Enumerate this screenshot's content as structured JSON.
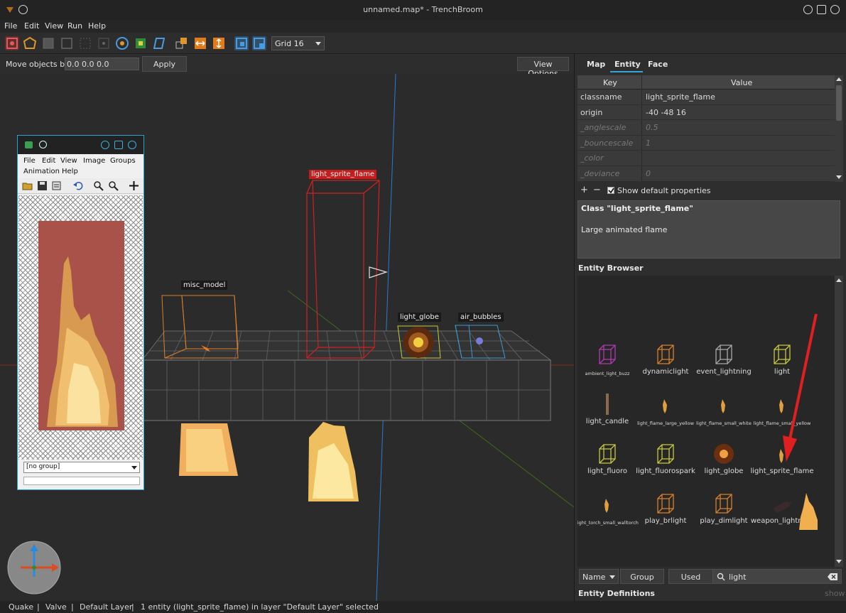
{
  "window": {
    "title": "unnamed.map* - TrenchBroom"
  },
  "menu": {
    "items": [
      "File",
      "Edit",
      "View",
      "Run",
      "Help"
    ]
  },
  "toolbar": {
    "grid_value": "Grid 16",
    "tools": [
      "select-brush-icon",
      "vertex-tool-icon",
      "edge-tool-icon",
      "face-tool-icon",
      "clip-tool-icon",
      "rotate-tool-icon",
      "texture-lock-icon",
      "uv-lock-icon",
      "shear-tool-icon",
      "duplicate-icon",
      "flip-horizontal-icon",
      "flip-vertical-icon",
      "snap-vertices-icon",
      "snap-grid-icon"
    ]
  },
  "move_bar": {
    "label": "Move objects by",
    "value": "0.0 0.0 0.0",
    "apply_label": "Apply",
    "view_options_label": "View Options"
  },
  "viewport": {
    "labels": {
      "sprite_flame": "light_sprite_flame",
      "misc_model": "misc_model",
      "light_globe": "light_globe",
      "air_bubbles": "air_bubbles"
    }
  },
  "image_viewer": {
    "menu": [
      "File",
      "Edit",
      "View",
      "Image",
      "Groups",
      "Animation",
      "Help"
    ],
    "group_select": "[no group]"
  },
  "inspector": {
    "tabs": [
      "Map",
      "Entity",
      "Face"
    ],
    "active_tab": "Entity",
    "table_headers": {
      "key": "Key",
      "value": "Value"
    },
    "rows": [
      {
        "key": "classname",
        "value": "light_sprite_flame",
        "default": false
      },
      {
        "key": "origin",
        "value": "-40 -48 16",
        "default": false
      },
      {
        "key": "_anglescale",
        "value": "0.5",
        "default": true
      },
      {
        "key": "_bouncescale",
        "value": "1",
        "default": true
      },
      {
        "key": "_color",
        "value": "",
        "default": true
      },
      {
        "key": "_deviance",
        "value": "0",
        "default": true
      }
    ],
    "add_label": "+",
    "remove_label": "−",
    "show_default_label": "Show default properties",
    "class_title": "Class \"light_sprite_flame\"",
    "class_description": "Large animated flame"
  },
  "entity_browser": {
    "title": "Entity Browser",
    "entities": [
      {
        "name": "ambient_light_buzz",
        "small": true,
        "color": "#b03ab0"
      },
      {
        "name": "dynamiclight",
        "small": false,
        "color": "#d8802a"
      },
      {
        "name": "event_lightning",
        "small": false,
        "color": "#a8a8a8"
      },
      {
        "name": "light",
        "small": false,
        "color": "#c8c83a"
      },
      {
        "name": "light_candle",
        "small": false,
        "color": "#8a6a4a"
      },
      {
        "name": "light_flame_large_yellow",
        "small": true,
        "color": "#e0a040"
      },
      {
        "name": "light_flame_small_white",
        "small": true,
        "color": "#e0a040"
      },
      {
        "name": "light_flame_small_yellow",
        "small": true,
        "color": "#e0a040"
      },
      {
        "name": "light_fluoro",
        "small": false,
        "color": "#c8c83a"
      },
      {
        "name": "light_fluorospark",
        "small": false,
        "color": "#c8c83a"
      },
      {
        "name": "light_globe",
        "small": false,
        "color": "#d07020"
      },
      {
        "name": "light_sprite_flame",
        "small": false,
        "color": "#e0a040"
      },
      {
        "name": "light_torch_small_walltorch",
        "small": true,
        "color": "#e0a040"
      },
      {
        "name": "play_brlight",
        "small": false,
        "color": "#d8802a"
      },
      {
        "name": "play_dimlight",
        "small": false,
        "color": "#d8802a"
      },
      {
        "name": "weapon_lightning",
        "small": false,
        "color": "#555"
      }
    ],
    "sort_select": "Name",
    "group_label": "Group",
    "used_label": "Used",
    "search_value": "light"
  },
  "entity_definitions": {
    "title": "Entity Definitions",
    "show_label": "show"
  },
  "status_bar": {
    "game": "Quake",
    "format": "Valve",
    "layer": "Default Layer",
    "selection": "1 entity (light_sprite_flame) in layer \"Default Layer\" selected"
  },
  "colors": {
    "accent_cyan": "#2aa0d0",
    "selection_red": "#c41d1d",
    "annotation_arrow": "#e02020"
  }
}
